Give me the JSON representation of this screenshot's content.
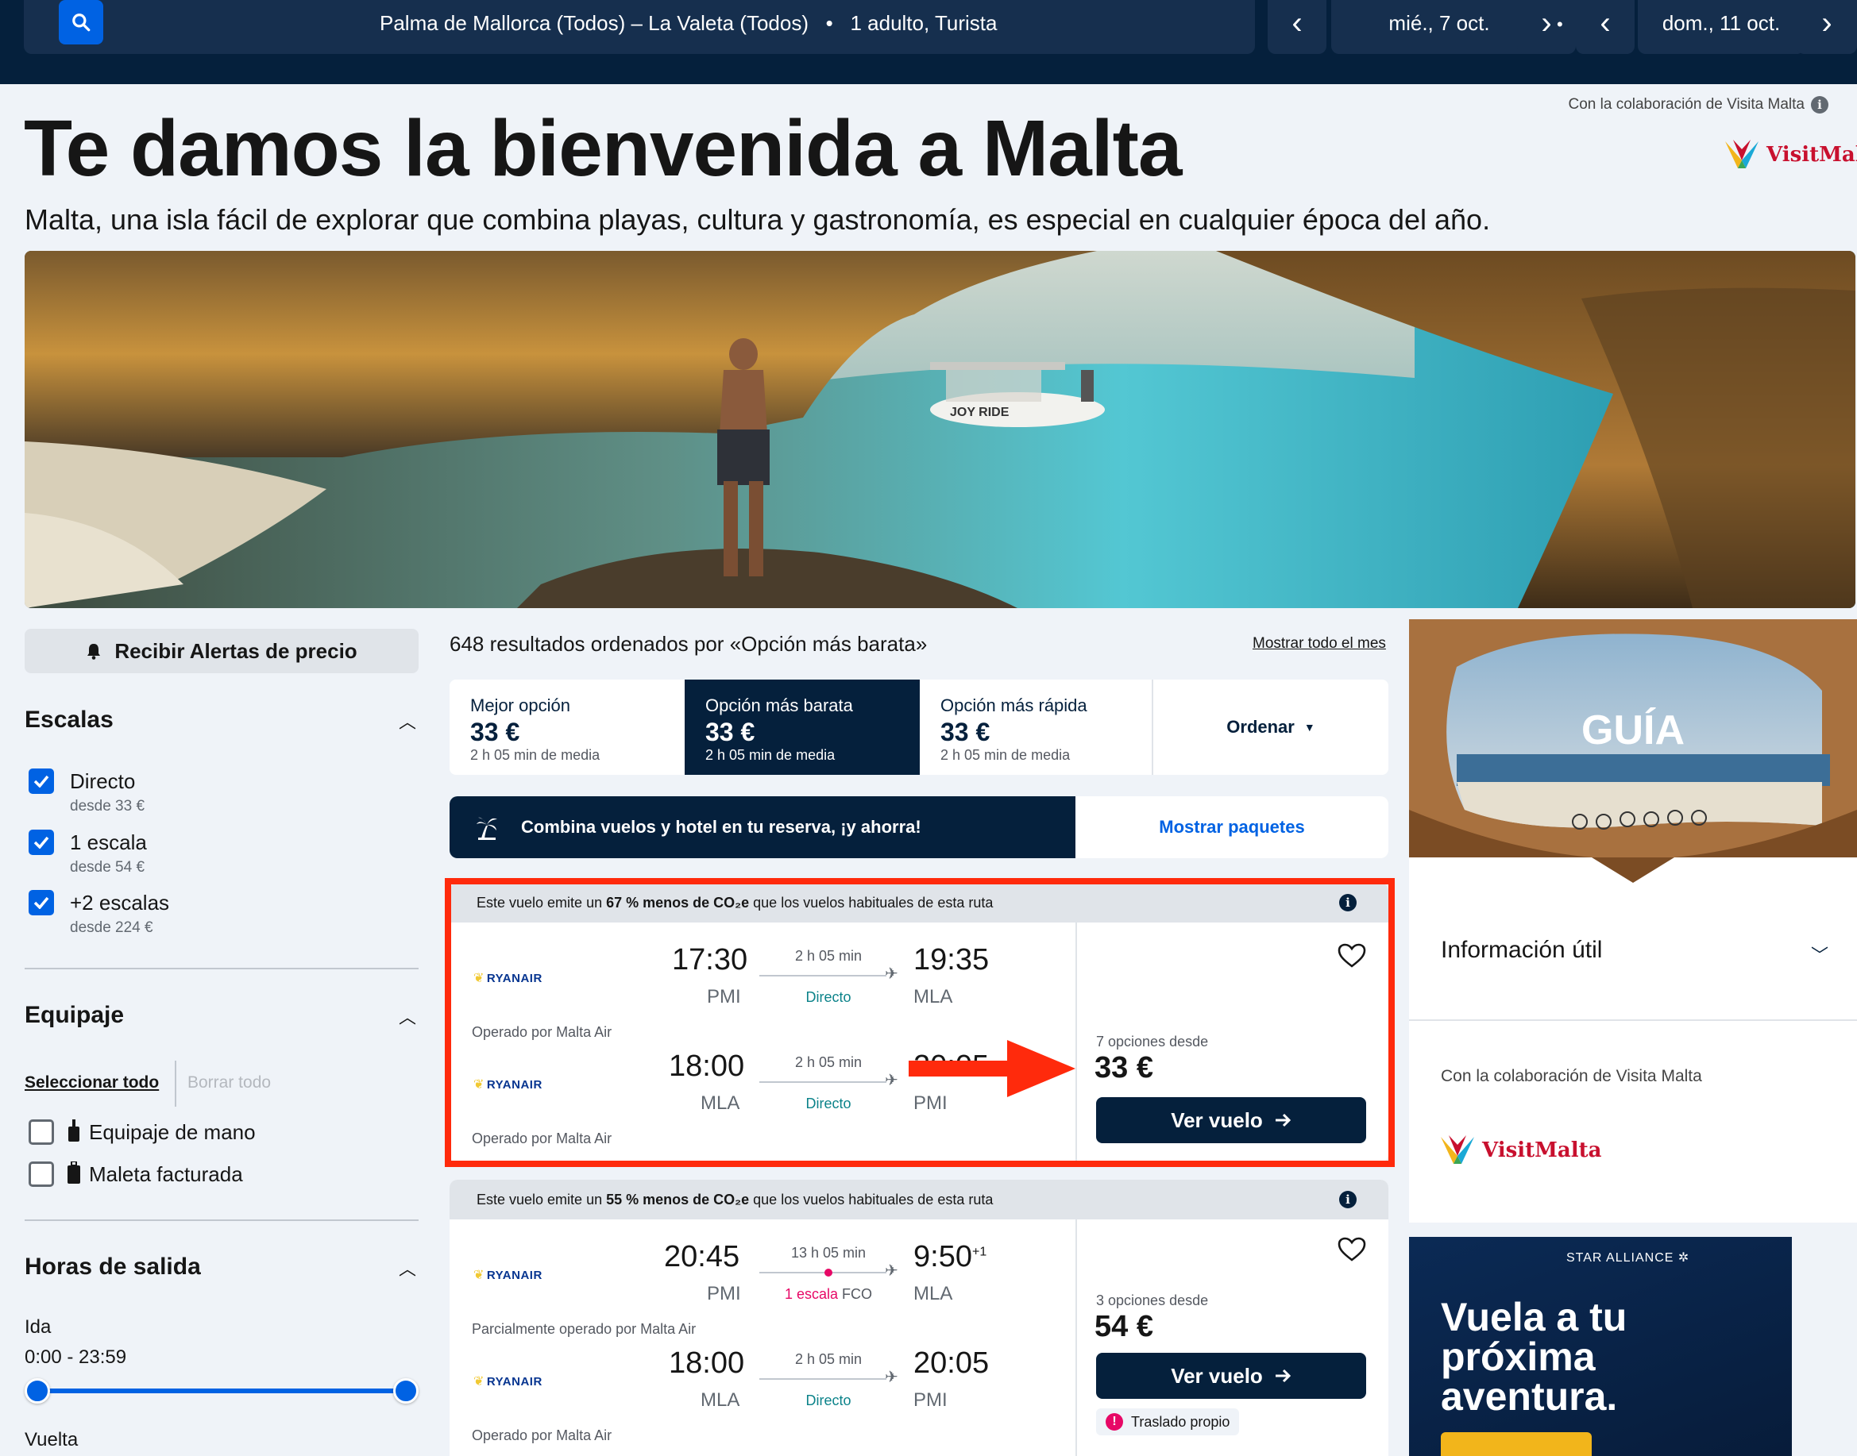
{
  "topbar": {
    "route": "Palma de Mallorca (Todos) – La Valeta (Todos)",
    "travellers": "1 adulto, Turista",
    "depart_date": "mié., 7 oct.",
    "return_date": "dom., 11 oct."
  },
  "header": {
    "title": "Te damos la bienvenida a Malta",
    "subtitle": "Malta, una isla fácil de explorar que combina playas, cultura y gastronomía, es especial en cualquier época del año.",
    "collab": "Con la colaboración de Visita Malta",
    "logo_text": "VisitMalta"
  },
  "sidebar": {
    "alert_button": "Recibir Alertas de precio",
    "stops": {
      "title": "Escalas",
      "options": [
        {
          "label": "Directo",
          "sub": "desde 33 €",
          "checked": true
        },
        {
          "label": "1 escala",
          "sub": "desde 54 €",
          "checked": true
        },
        {
          "label": "+2 escalas",
          "sub": "desde 224 €",
          "checked": true
        }
      ]
    },
    "baggage": {
      "title": "Equipaje",
      "select_all": "Seleccionar todo",
      "clear_all": "Borrar todo",
      "options": [
        {
          "label": "Equipaje de mano",
          "checked": false
        },
        {
          "label": "Maleta facturada",
          "checked": false
        }
      ]
    },
    "departure_times": {
      "title": "Horas de salida",
      "outbound_label": "Ida",
      "outbound_range": "0:00 - 23:59",
      "return_label": "Vuelta"
    }
  },
  "results": {
    "count_text": "648 resultados ordenados por «Opción más barata»",
    "show_month": "Mostrar todo el mes",
    "sort_tabs": [
      {
        "label": "Mejor opción",
        "price": "33 €",
        "avg": "2 h 05 min de media"
      },
      {
        "label": "Opción más barata",
        "price": "33 €",
        "avg": "2 h 05 min de media"
      },
      {
        "label": "Opción más rápida",
        "price": "33 €",
        "avg": "2 h 05 min de media"
      }
    ],
    "sort_dropdown": "Ordenar",
    "promo": {
      "text": "Combina vuelos y hotel en tu reserva, ¡y ahorra!",
      "link": "Mostrar paquetes"
    },
    "cards": [
      {
        "eco_prefix": "Este vuelo emite un ",
        "eco_bold": "67 % menos de CO₂e",
        "eco_suffix": " que los vuelos habituales de esta ruta",
        "legs": [
          {
            "airline": "RYANAIR",
            "dep_time": "17:30",
            "dep_code": "PMI",
            "duration": "2 h 05 min",
            "stops": "Directo",
            "arr_time": "19:35",
            "arr_code": "MLA",
            "operated": "Operado por Malta Air"
          },
          {
            "airline": "RYANAIR",
            "dep_time": "18:00",
            "dep_code": "MLA",
            "duration": "2 h 05 min",
            "stops": "Directo",
            "arr_time": "20:05",
            "arr_code": "PMI",
            "operated": "Operado por Malta Air"
          }
        ],
        "options_text": "7 opciones desde",
        "price": "33 €",
        "button": "Ver vuelo"
      },
      {
        "eco_prefix": "Este vuelo emite un ",
        "eco_bold": "55 % menos de CO₂e",
        "eco_suffix": " que los vuelos habituales de esta ruta",
        "legs": [
          {
            "airline": "RYANAIR",
            "dep_time": "20:45",
            "dep_code": "PMI",
            "duration": "13 h 05 min",
            "stops": "1 escala",
            "stop_airport": "FCO",
            "arr_time": "9:50",
            "arr_sup": "+1",
            "arr_code": "MLA",
            "operated": "Parcialmente operado por Malta Air"
          },
          {
            "airline": "RYANAIR",
            "dep_time": "18:00",
            "dep_code": "MLA",
            "duration": "2 h 05 min",
            "stops": "Directo",
            "arr_time": "20:05",
            "arr_code": "PMI",
            "operated": "Operado por Malta Air"
          }
        ],
        "options_text": "3 opciones desde",
        "price": "54 €",
        "button": "Ver vuelo",
        "badge": "Traslado propio"
      }
    ]
  },
  "guide": {
    "title": "GUÍA",
    "info": "Información útil",
    "collab": "Con la colaboración de Visita Malta",
    "logo_text": "VisitMalta"
  },
  "ad": {
    "brand": "STAR ALLIANCE",
    "headline": "Vuela a tu próxima aventura."
  },
  "colors": {
    "navy": "#05203c",
    "blue": "#0062e3",
    "highlight_red": "#ff2a0c",
    "direct_green": "#0c838a",
    "stop_red": "#e70866"
  }
}
